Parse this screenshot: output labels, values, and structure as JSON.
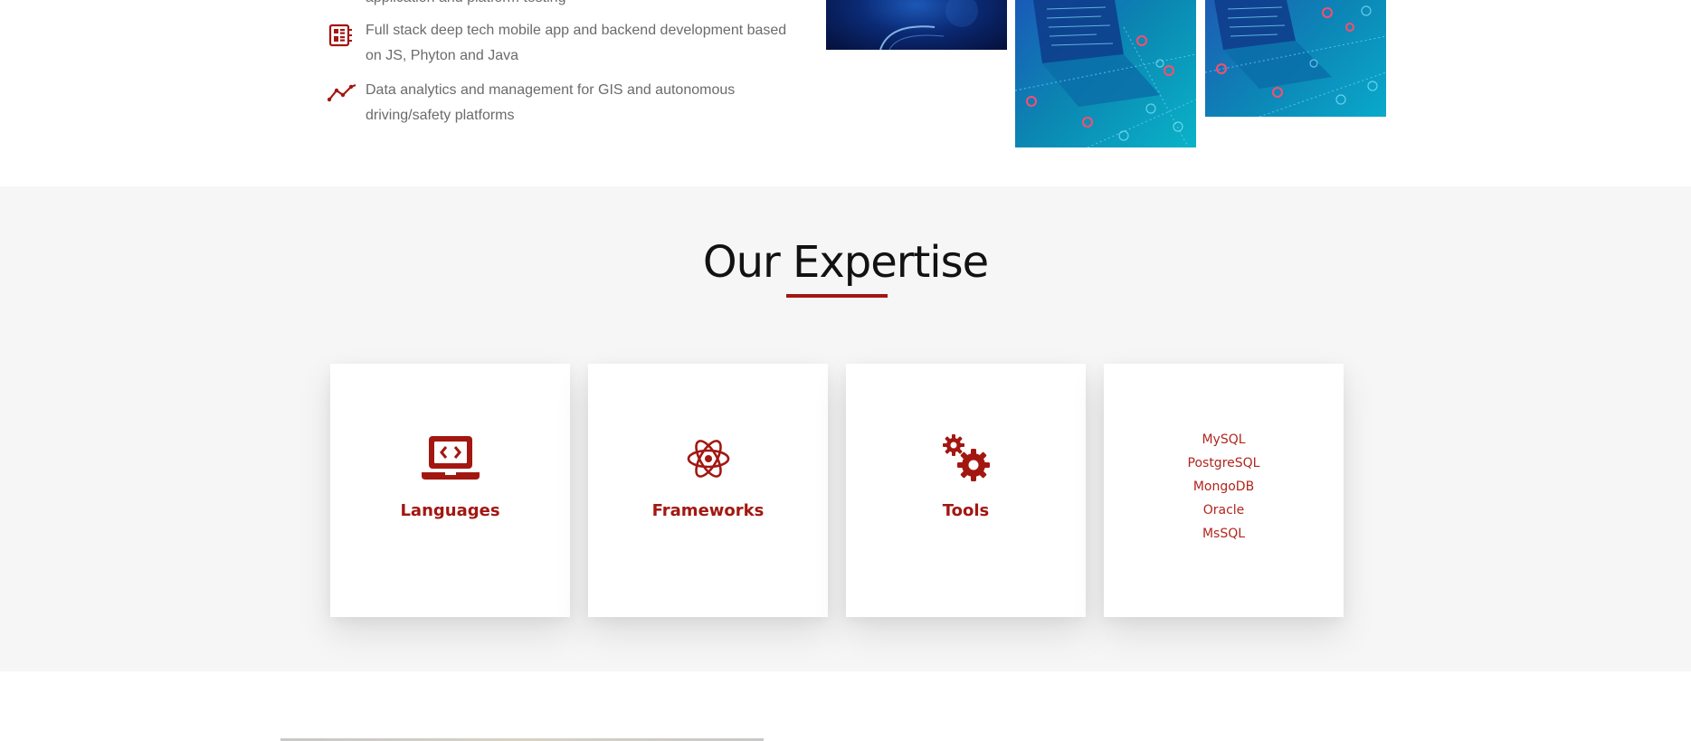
{
  "features": [
    {
      "icon": "monitor-grid-icon",
      "text": "application and platform testing"
    },
    {
      "icon": "circuit-board-icon",
      "text": "Full stack deep tech mobile app and backend development based on JS, Phyton and Java"
    },
    {
      "icon": "trend-line-icon",
      "text": "Data analytics and management for GIS and autonomous driving/safety platforms"
    }
  ],
  "expertise": {
    "title": "Our Expertise",
    "cards": [
      {
        "icon": "laptop-code-icon",
        "label": "Languages"
      },
      {
        "icon": "atom-icon",
        "label": "Frameworks"
      },
      {
        "icon": "gears-icon",
        "label": "Tools"
      }
    ],
    "databases": [
      "MySQL",
      "PostgreSQL",
      "MongoDB",
      "Oracle",
      "MsSQL"
    ]
  },
  "colors": {
    "accent": "#a31711",
    "section_bg": "#f6f6f6",
    "body_text": "#6b6b6b"
  }
}
